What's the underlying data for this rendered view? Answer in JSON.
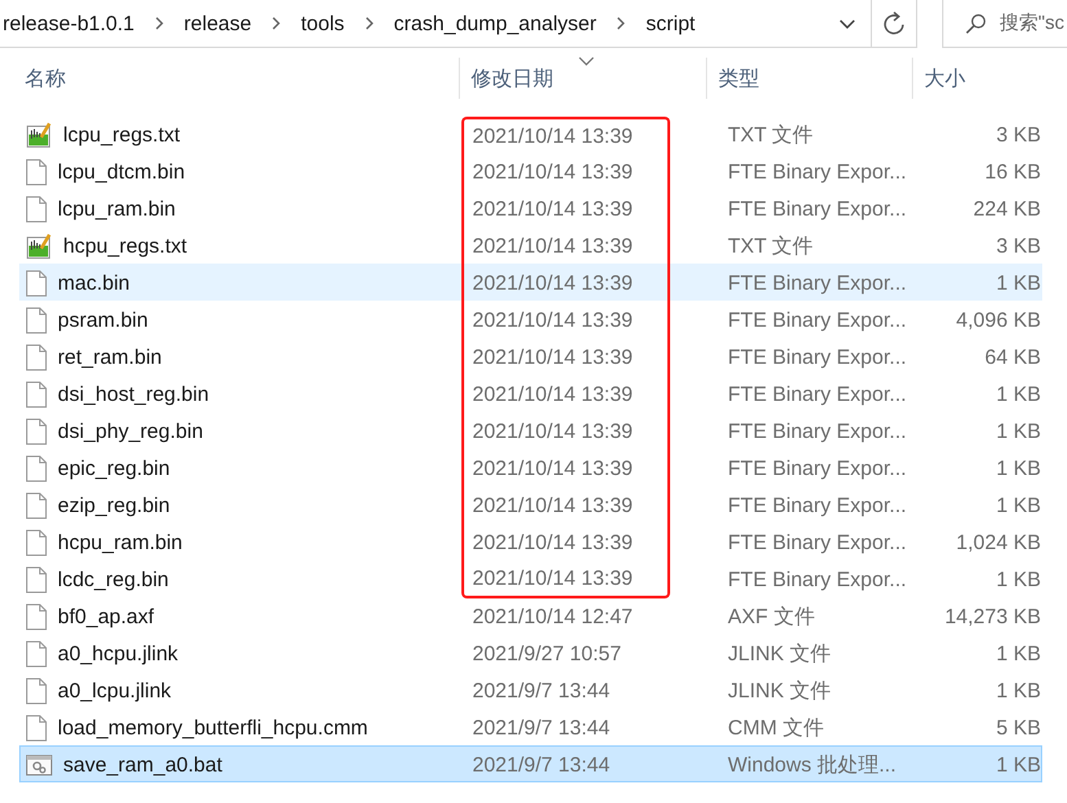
{
  "address_bar": {
    "path": [
      "release-b1.0.1",
      "release",
      "tools",
      "crash_dump_analyser",
      "script"
    ]
  },
  "search": {
    "placeholder": "搜索\"sc"
  },
  "columns": [
    {
      "label": "名称",
      "sorted": false
    },
    {
      "label": "修改日期",
      "sorted": true
    },
    {
      "label": "类型",
      "sorted": false
    },
    {
      "label": "大小",
      "sorted": false
    }
  ],
  "rows": [
    {
      "name": "lcpu_regs.txt",
      "kind": "text",
      "date": "2021/10/14 13:39",
      "type": "TXT 文件",
      "size": "3 KB",
      "selected": false,
      "hovered": false,
      "boxed": true
    },
    {
      "name": "lcpu_dtcm.bin",
      "kind": "file",
      "date": "2021/10/14 13:39",
      "type": "FTE Binary Expor...",
      "size": "16 KB",
      "selected": false,
      "hovered": false,
      "boxed": true
    },
    {
      "name": "lcpu_ram.bin",
      "kind": "file",
      "date": "2021/10/14 13:39",
      "type": "FTE Binary Expor...",
      "size": "224 KB",
      "selected": false,
      "hovered": false,
      "boxed": true
    },
    {
      "name": "hcpu_regs.txt",
      "kind": "text",
      "date": "2021/10/14 13:39",
      "type": "TXT 文件",
      "size": "3 KB",
      "selected": false,
      "hovered": false,
      "boxed": true
    },
    {
      "name": "mac.bin",
      "kind": "file",
      "date": "2021/10/14 13:39",
      "type": "FTE Binary Expor...",
      "size": "1 KB",
      "selected": false,
      "hovered": true,
      "boxed": true
    },
    {
      "name": "psram.bin",
      "kind": "file",
      "date": "2021/10/14 13:39",
      "type": "FTE Binary Expor...",
      "size": "4,096 KB",
      "selected": false,
      "hovered": false,
      "boxed": true
    },
    {
      "name": "ret_ram.bin",
      "kind": "file",
      "date": "2021/10/14 13:39",
      "type": "FTE Binary Expor...",
      "size": "64 KB",
      "selected": false,
      "hovered": false,
      "boxed": true
    },
    {
      "name": "dsi_host_reg.bin",
      "kind": "file",
      "date": "2021/10/14 13:39",
      "type": "FTE Binary Expor...",
      "size": "1 KB",
      "selected": false,
      "hovered": false,
      "boxed": true
    },
    {
      "name": "dsi_phy_reg.bin",
      "kind": "file",
      "date": "2021/10/14 13:39",
      "type": "FTE Binary Expor...",
      "size": "1 KB",
      "selected": false,
      "hovered": false,
      "boxed": true
    },
    {
      "name": "epic_reg.bin",
      "kind": "file",
      "date": "2021/10/14 13:39",
      "type": "FTE Binary Expor...",
      "size": "1 KB",
      "selected": false,
      "hovered": false,
      "boxed": true
    },
    {
      "name": "ezip_reg.bin",
      "kind": "file",
      "date": "2021/10/14 13:39",
      "type": "FTE Binary Expor...",
      "size": "1 KB",
      "selected": false,
      "hovered": false,
      "boxed": true
    },
    {
      "name": "hcpu_ram.bin",
      "kind": "file",
      "date": "2021/10/14 13:39",
      "type": "FTE Binary Expor...",
      "size": "1,024 KB",
      "selected": false,
      "hovered": false,
      "boxed": true
    },
    {
      "name": "lcdc_reg.bin",
      "kind": "file",
      "date": "2021/10/14 13:39",
      "type": "FTE Binary Expor...",
      "size": "1 KB",
      "selected": false,
      "hovered": false,
      "boxed": true
    },
    {
      "name": "bf0_ap.axf",
      "kind": "file",
      "date": "2021/10/14 12:47",
      "type": "AXF 文件",
      "size": "14,273 KB",
      "selected": false,
      "hovered": false,
      "boxed": false
    },
    {
      "name": "a0_hcpu.jlink",
      "kind": "file",
      "date": "2021/9/27 10:57",
      "type": "JLINK 文件",
      "size": "1 KB",
      "selected": false,
      "hovered": false,
      "boxed": false
    },
    {
      "name": "a0_lcpu.jlink",
      "kind": "file",
      "date": "2021/9/7 13:44",
      "type": "JLINK 文件",
      "size": "1 KB",
      "selected": false,
      "hovered": false,
      "boxed": false
    },
    {
      "name": "load_memory_butterfli_hcpu.cmm",
      "kind": "file",
      "date": "2021/9/7 13:44",
      "type": "CMM 文件",
      "size": "5 KB",
      "selected": false,
      "hovered": false,
      "boxed": false
    },
    {
      "name": "save_ram_a0.bat",
      "kind": "batch",
      "date": "2021/9/7 13:44",
      "type": "Windows 批处理...",
      "size": "1 KB",
      "selected": true,
      "hovered": false,
      "boxed": false
    }
  ]
}
